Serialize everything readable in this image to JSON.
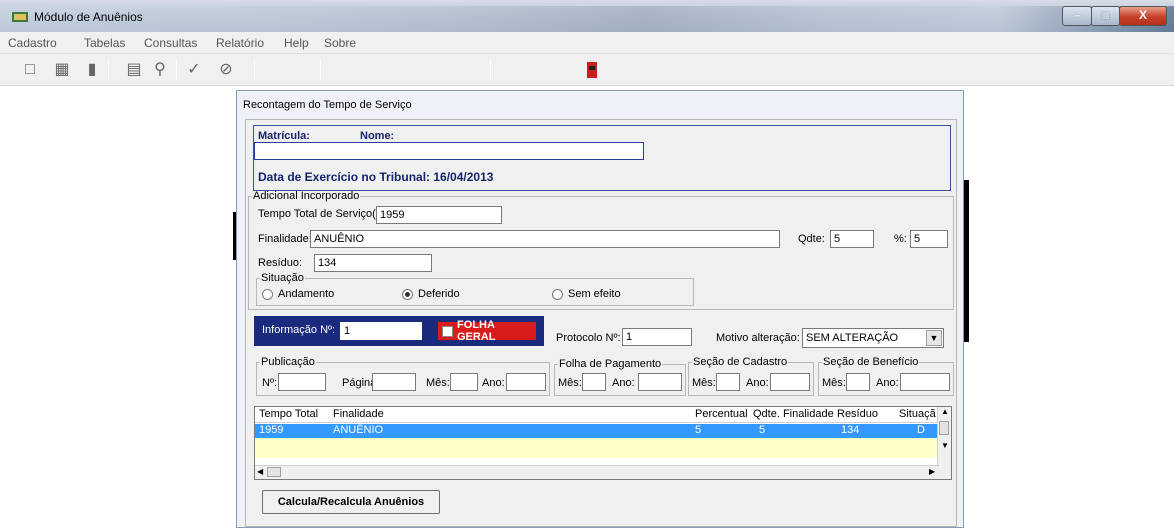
{
  "window": {
    "title": "Módulo de Anuênios",
    "close_glyph": "X",
    "min_glyph": "–",
    "max_glyph": "□"
  },
  "menu": [
    "Cadastro",
    "Tabelas",
    "Consultas",
    "Relatório",
    "Help",
    "Sobre"
  ],
  "toolbar_icons": [
    "new-icon",
    "import-icon",
    "delete-icon",
    "print-icon",
    "zoom-icon",
    "check-icon",
    "cancel-icon",
    "exit-icon"
  ],
  "dialog": {
    "title": "Recontagem do Tempo de Serviço",
    "matricula_label": "Matrícula:",
    "nome_label": "Nome:",
    "nome_value": "",
    "data_exercicio": "Data de Exercício no Tribunal:  16/04/2013",
    "adicional": {
      "legend": "Adicional Incorporado",
      "tempo_label": "Tempo Total de Serviço(dias):",
      "tempo_value": "1959",
      "finalidade_label": "Finalidade:",
      "finalidade_value": "ANUÊNIO",
      "qdte_label": "Qdte:",
      "qdte_value": "5",
      "pct_label": "%:",
      "pct_value": "5",
      "residuo_label": "Resíduo:",
      "residuo_value": "134"
    },
    "situacao": {
      "legend": "Situação",
      "options": [
        "Andamento",
        "Deferido",
        "Sem efeito"
      ],
      "selected": "Deferido"
    },
    "informacao_label": "Informação Nº:",
    "informacao_value": "1",
    "folha_geral": "FOLHA GERAL",
    "protocolo_label": "Protocolo Nº:",
    "protocolo_value": "1",
    "motivo_label": "Motivo alteração:",
    "motivo_value": "SEM ALTERAÇÃO",
    "publicacao": {
      "legend": "Publicação",
      "n_label": "Nº:",
      "pagina_label": "Página:",
      "mes_label": "Mês:",
      "ano_label": "Ano:"
    },
    "folha_pagamento": {
      "legend": "Folha de Pagamento",
      "mes_label": "Mês:",
      "ano_label": "Ano:"
    },
    "secao_cadastro": {
      "legend": "Seção de Cadastro",
      "mes_label": "Mês:",
      "ano_label": "Ano:"
    },
    "secao_beneficio": {
      "legend": "Seção de Benefício",
      "mes_label": "Mês:",
      "ano_label": "Ano:"
    },
    "grid": {
      "headers": [
        "Tempo Total",
        "Finalidade",
        "Percentual",
        "Qdte. Finalidade",
        "Resíduo",
        "Situaçã"
      ],
      "rows": [
        [
          "1959",
          "ANUÊNIO",
          "5",
          "5",
          "134",
          "D"
        ]
      ]
    },
    "calc_button": "Calcula/Recalcula Anuênios"
  }
}
